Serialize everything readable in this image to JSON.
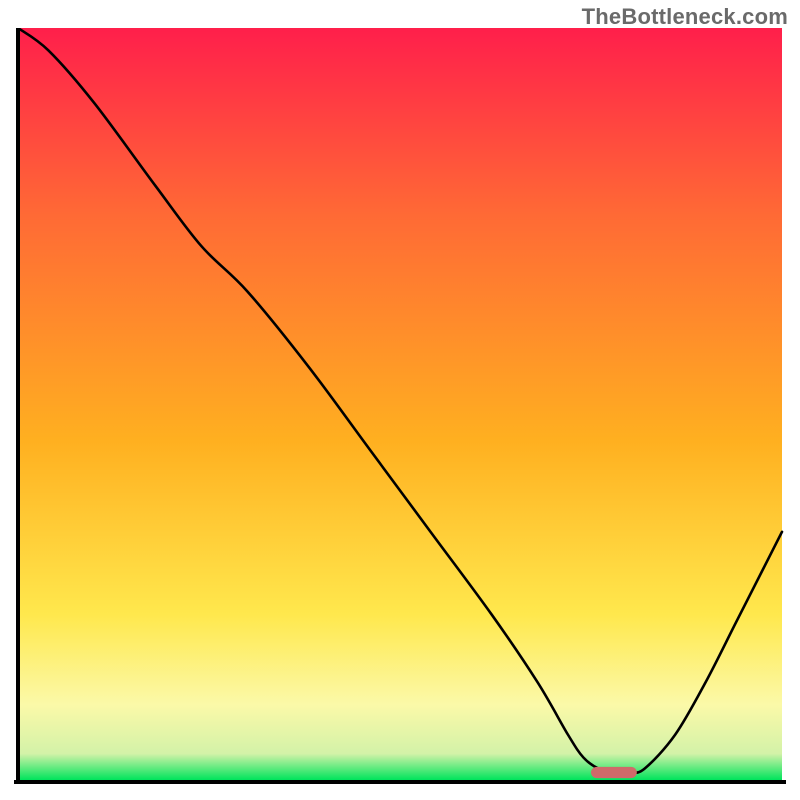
{
  "watermark": "TheBottleneck.com",
  "chart_data": {
    "type": "line",
    "title": "",
    "xlabel": "",
    "ylabel": "",
    "xlim": [
      0,
      100
    ],
    "ylim": [
      0,
      100
    ],
    "grid": false,
    "axes_labeled": false,
    "background_gradient": {
      "stops": [
        {
          "offset": 0.0,
          "color": "#ff1f4b"
        },
        {
          "offset": 0.25,
          "color": "#ff6a35"
        },
        {
          "offset": 0.55,
          "color": "#ffb020"
        },
        {
          "offset": 0.78,
          "color": "#ffe84d"
        },
        {
          "offset": 0.9,
          "color": "#fbf9a8"
        },
        {
          "offset": 0.965,
          "color": "#d3f2a8"
        },
        {
          "offset": 1.0,
          "color": "#00e45c"
        }
      ]
    },
    "series": [
      {
        "name": "bottleneck-curve",
        "color": "#000000",
        "x": [
          0,
          4,
          10,
          18,
          24,
          30,
          38,
          46,
          54,
          62,
          68,
          72,
          74,
          76,
          78,
          80,
          82,
          86,
          90,
          94,
          98,
          100
        ],
        "y": [
          100,
          97,
          90,
          79,
          71,
          65,
          55,
          44,
          33,
          22,
          13,
          6,
          3,
          1.5,
          1,
          1,
          1.5,
          6,
          13,
          21,
          29,
          33
        ]
      }
    ],
    "marker": {
      "name": "optimal-pill",
      "shape": "rounded-rect",
      "x_center": 78,
      "y_center": 1,
      "width": 6,
      "height": 1.5,
      "color": "#cf6a6a"
    },
    "notes": "Axes carry no tick labels or titles in the source image; numeric values are estimated on a 0–100 normalized scale from visual position. The curve descends from top-left, reaches a minimum near x≈78 (green band), then rises toward the right edge."
  }
}
